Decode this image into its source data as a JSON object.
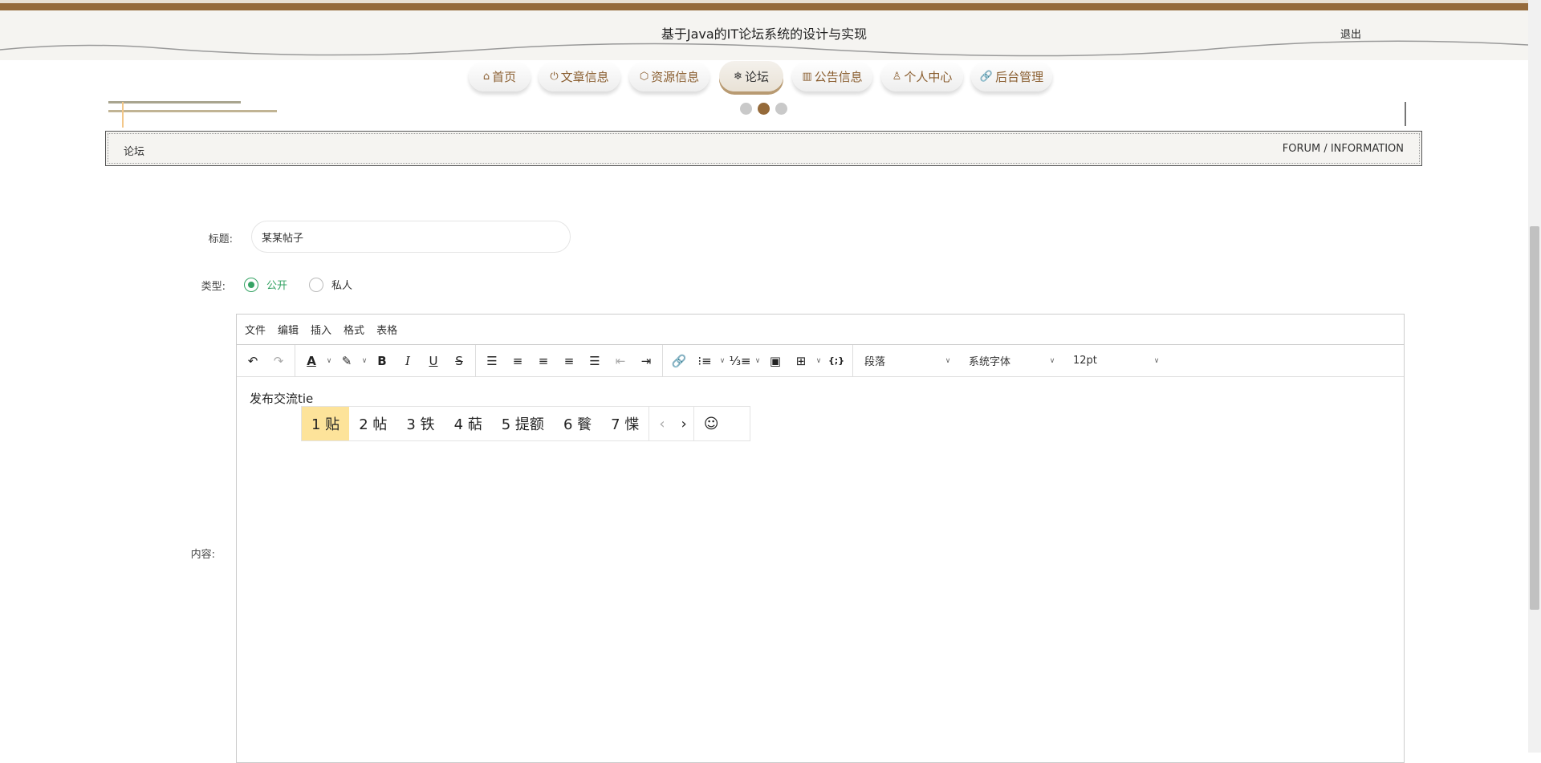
{
  "header": {
    "title": "基于Java的IT论坛系统的设计与实现",
    "logout": "退出"
  },
  "nav": [
    {
      "label": "首页",
      "icon": "⌂"
    },
    {
      "label": "文章信息",
      "icon": "⏻"
    },
    {
      "label": "资源信息",
      "icon": "⬡"
    },
    {
      "label": "论坛",
      "icon": "❄"
    },
    {
      "label": "公告信息",
      "icon": "▥"
    },
    {
      "label": "个人中心",
      "icon": "♙"
    },
    {
      "label": "后台管理",
      "icon": "🔗"
    }
  ],
  "carousel": {
    "count": 3,
    "active": 2
  },
  "breadcrumb": {
    "left": "论坛",
    "right": "FORUM / INFORMATION"
  },
  "form": {
    "title_label": "标题:",
    "title_value": "某某帖子",
    "type_label": "类型:",
    "type_options": [
      "公开",
      "私人"
    ],
    "type_selected": "公开",
    "content_label": "内容:"
  },
  "editor": {
    "menus": [
      "文件",
      "编辑",
      "插入",
      "格式",
      "表格"
    ],
    "block_format": "段落",
    "font_family": "系统字体",
    "font_size": "12pt",
    "content": "发布交流tie"
  },
  "ime": {
    "candidates": [
      "1 贴",
      "2 帖",
      "3 铁",
      "4 萜",
      "5 提额",
      "6 餮",
      "7 惵"
    ],
    "prev": "‹",
    "next": "›",
    "emoji": "☺"
  }
}
